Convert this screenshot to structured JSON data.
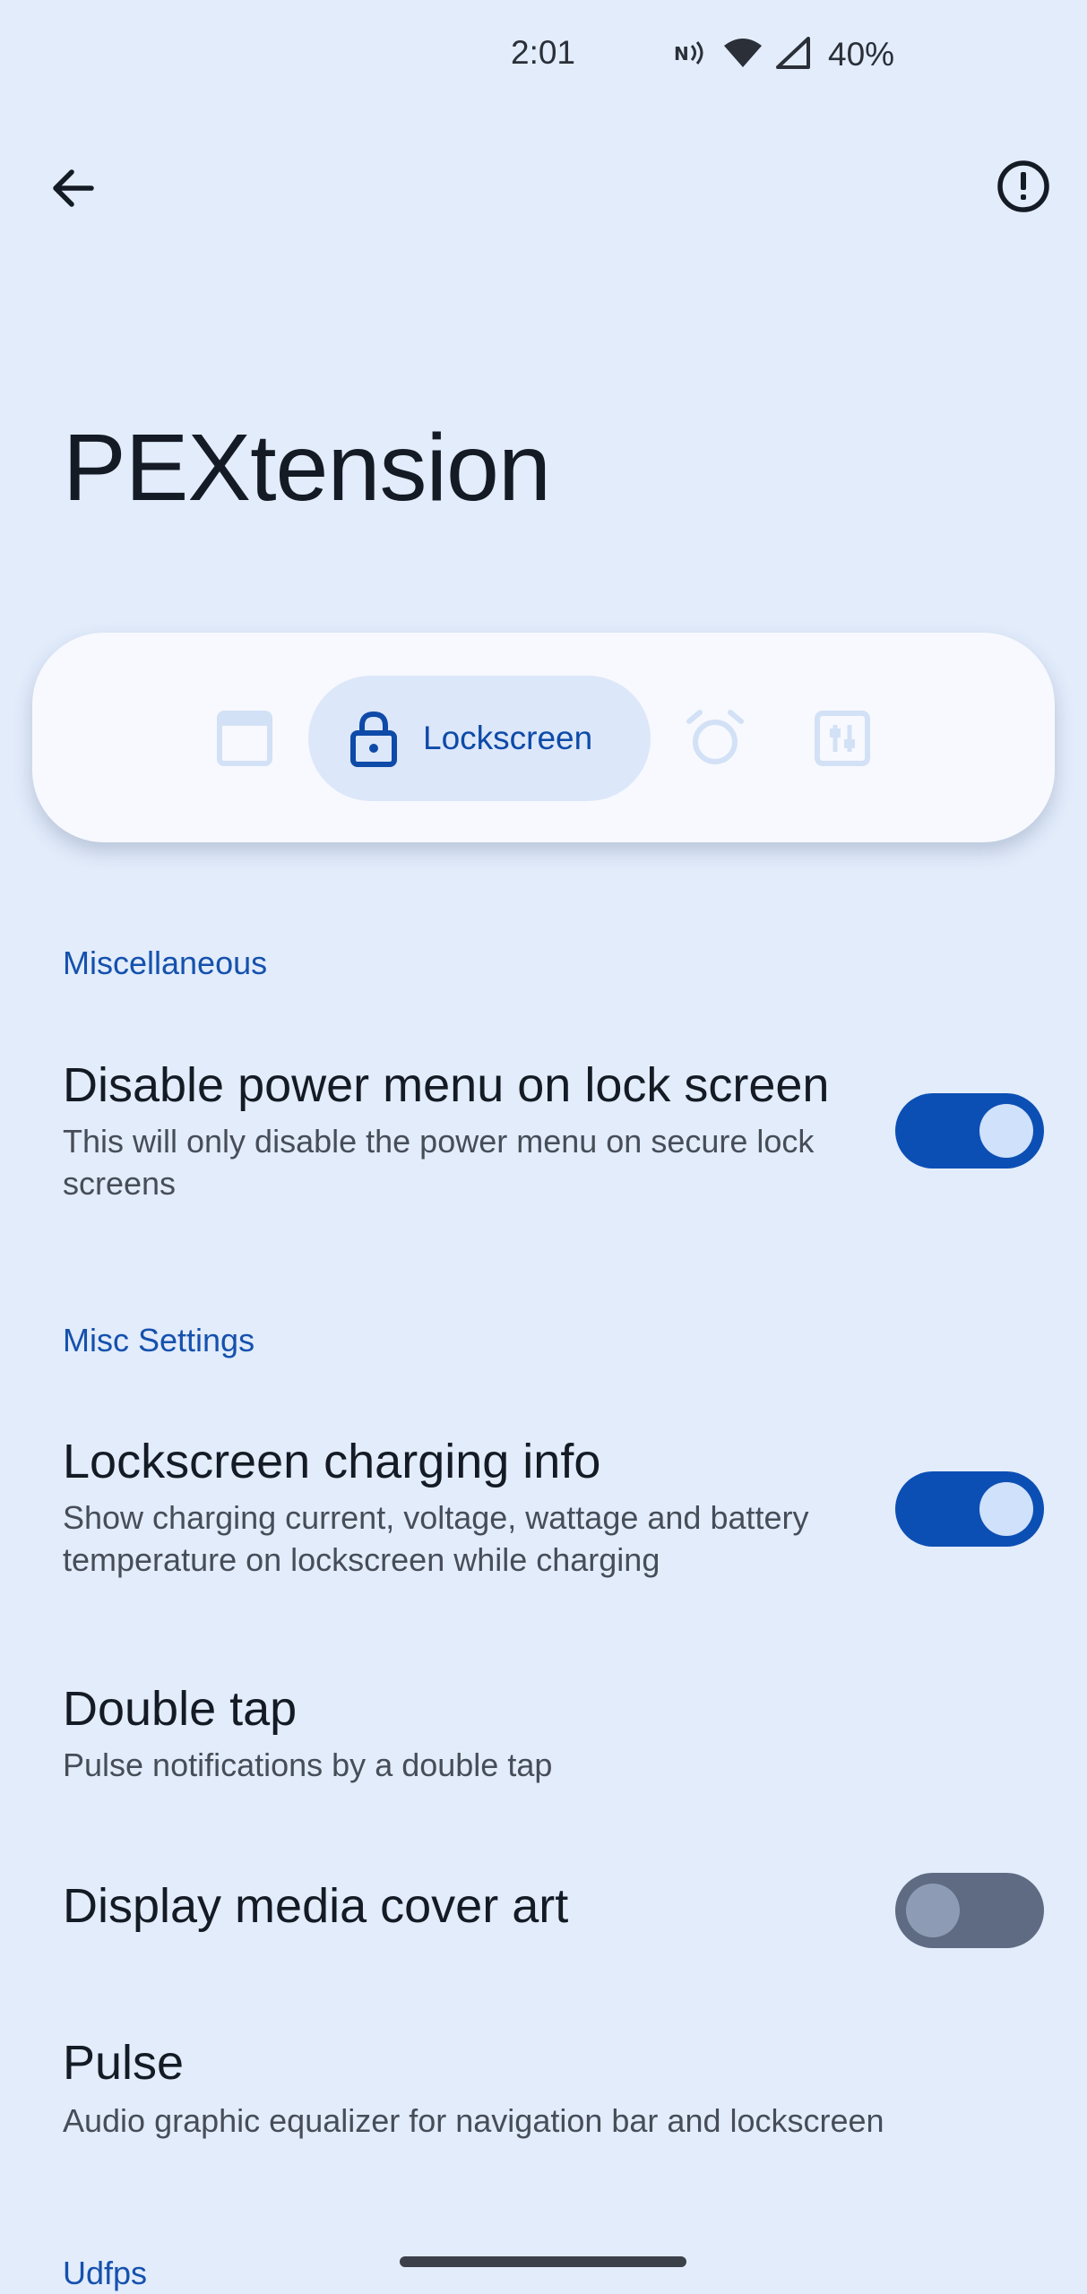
{
  "status_bar": {
    "time": "2:01",
    "battery": "40%"
  },
  "app_bar": {
    "back_icon": "arrow-back-icon",
    "info_icon": "info-outline-icon"
  },
  "page": {
    "title": "PEXtension"
  },
  "tabs": {
    "items": [
      {
        "icon": "window-icon",
        "label": ""
      },
      {
        "icon": "lock-icon",
        "label": "Lockscreen",
        "selected": true
      },
      {
        "icon": "alarm-icon",
        "label": ""
      },
      {
        "icon": "tune-icon",
        "label": ""
      }
    ],
    "active_label": "Lockscreen"
  },
  "sections": {
    "misc": {
      "header": "Miscellaneous",
      "power_menu": {
        "title": "Disable power menu on lock screen",
        "summary": "This will only disable the power menu on secure lock screens",
        "enabled": true
      }
    },
    "misc_settings": {
      "header": "Misc Settings",
      "charging_info": {
        "title": "Lockscreen charging info",
        "summary": "Show charging current, voltage, wattage and battery temperature on lockscreen while charging",
        "enabled": true
      },
      "double_tap": {
        "title": "Double tap",
        "summary": "Pulse notifications by a double tap"
      },
      "cover_art": {
        "title": "Display media cover art",
        "enabled": false
      },
      "pulse": {
        "title": "Pulse",
        "summary": "Audio graphic equalizer for navigation bar and lockscreen"
      }
    },
    "udfps": {
      "header": "Udfps"
    }
  },
  "colors": {
    "background": "#e2ecfb",
    "accent": "#0c4fb4",
    "section_header": "#1551ad"
  }
}
